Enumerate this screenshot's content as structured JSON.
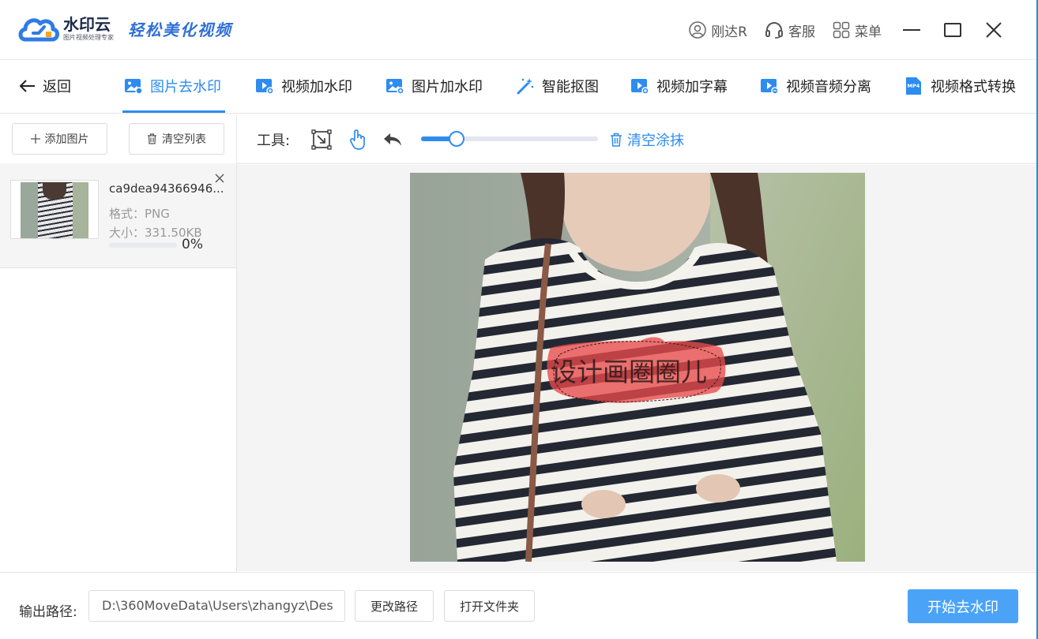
{
  "app": {
    "name": "水印云",
    "sub": "图片视频处理专家",
    "slogan": "轻松美化视频"
  },
  "titlebar": {
    "user": "刚达R",
    "service": "客服",
    "menu": "菜单"
  },
  "nav": {
    "back": "返回",
    "tabs": [
      {
        "label": "图片去水印",
        "active": true
      },
      {
        "label": "视频加水印"
      },
      {
        "label": "图片加水印"
      },
      {
        "label": "智能抠图"
      },
      {
        "label": "视频加字幕"
      },
      {
        "label": "视频音频分离"
      },
      {
        "label": "视频格式转换"
      }
    ],
    "mp4_badge": "MP4"
  },
  "left_panel": {
    "add_label": "添加图片",
    "clear_label": "清空列表",
    "files": [
      {
        "name": "ca9dea94366946...",
        "format": "格式：PNG",
        "size": "大小：331.50KB",
        "progress_text": "0%",
        "progress": 0
      }
    ]
  },
  "toolbar": {
    "label": "工具:",
    "brush_size": 0.21,
    "clear_paint": "清空涂抹"
  },
  "canvas": {
    "watermark_text": "设计画圈圈儿",
    "accent": "#2d8cf0",
    "mask_color": "#e84a4a"
  },
  "bottom": {
    "output_label": "输出路径:",
    "output_path": "D:\\360MoveData\\Users\\zhangyz\\Des",
    "change_path": "更改路径",
    "open_folder": "打开文件夹",
    "start": "开始去水印"
  }
}
